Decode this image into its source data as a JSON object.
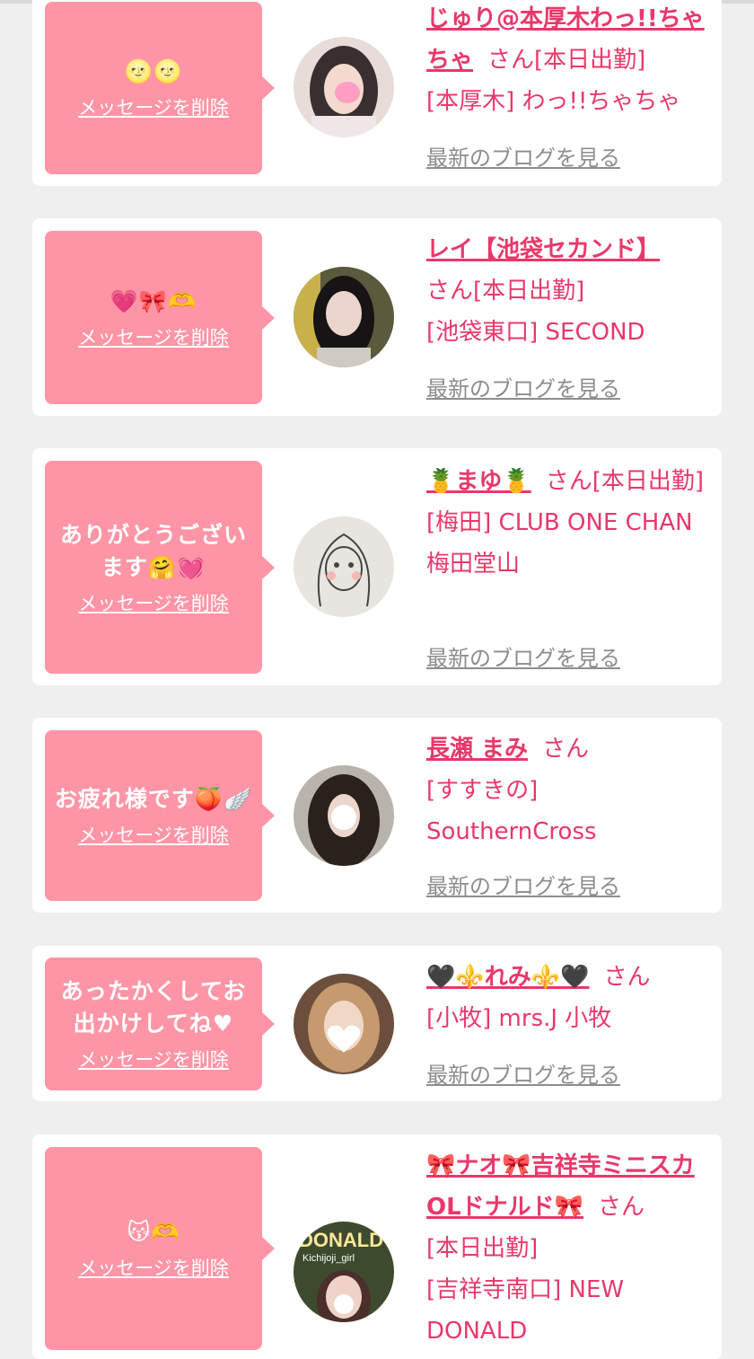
{
  "delete_label": "メッセージを削除",
  "blog_label": "最新のブログを見る",
  "san": "さん",
  "colors": {
    "accent": "#e8386a",
    "bubble": "#fe95a6",
    "background": "#efefef"
  },
  "entries": [
    {
      "message": "🌝🌝",
      "name": "じゅり@本厚木わっ!!ちゃちゃ",
      "status": "[本日出勤]",
      "shop": "[本厚木] わっ!!ちゃちゃ"
    },
    {
      "message": "💗🎀🫶",
      "name": "レイ【池袋セカンド】",
      "status": "[本日出勤]",
      "shop": "[池袋東口] SECOND"
    },
    {
      "message": "ありがとうございます🤗💓",
      "name": "🍍まゆ🍍",
      "status": "[本日出勤]",
      "shop": "[梅田] CLUB ONE CHAN 梅田堂山"
    },
    {
      "message": "お疲れ様です🍑🪽",
      "name": "長瀬 まみ",
      "status": "",
      "shop": "[すすきの] SouthernCross"
    },
    {
      "message": "あったかくしてお出かけしてね♥",
      "name": "🖤⚜️れみ⚜️🖤",
      "status": "",
      "shop": "[小牧] mrs.J 小牧"
    },
    {
      "message": "😽🫶",
      "name": "🎀ナオ🎀吉祥寺ミニスカOLドナルド🎀",
      "status": "[本日出勤]",
      "shop": "[吉祥寺南口] NEW DONALD",
      "avatar_text": [
        "DONALD",
        "Kichijoji_girl"
      ]
    }
  ]
}
